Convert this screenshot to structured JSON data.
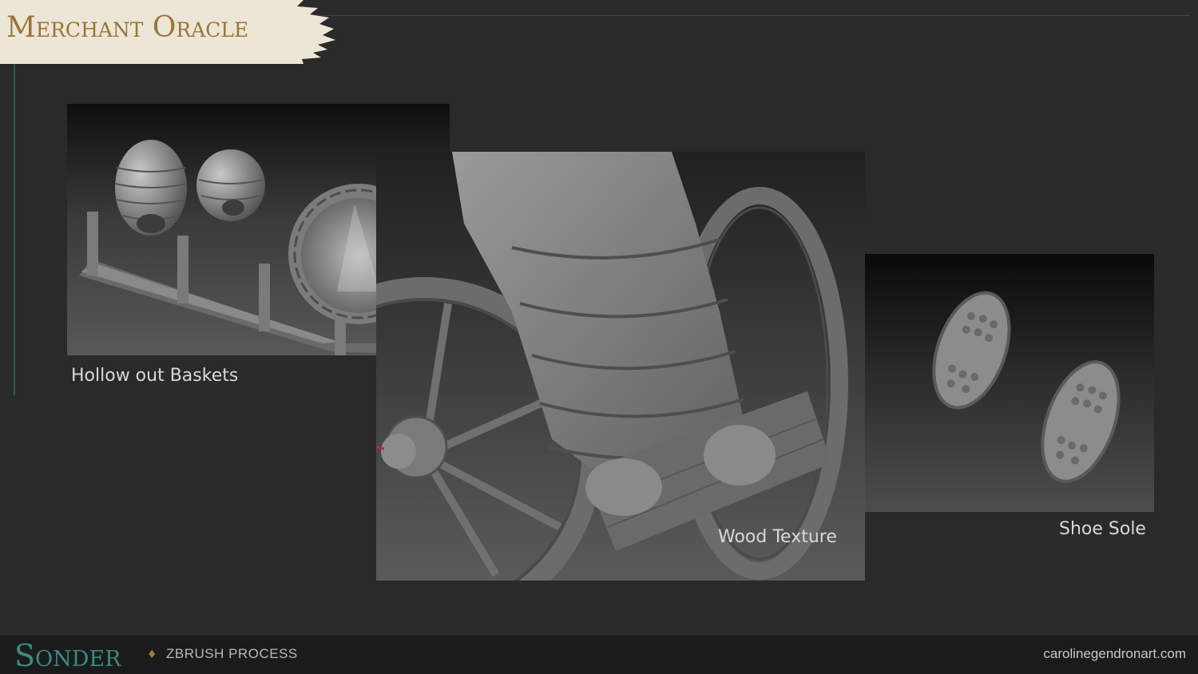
{
  "header": {
    "title": "Merchant Oracle"
  },
  "panels": [
    {
      "caption": "Hollow out Baskets"
    },
    {
      "caption": "Wood Texture"
    },
    {
      "caption": "Shoe Sole"
    }
  ],
  "footer": {
    "brand": "Sonder",
    "separator": "♦",
    "section": "ZBRUSH PROCESS",
    "website": "carolinegendronart.com"
  },
  "colors": {
    "background": "#2a2a2b",
    "accent_gold": "#9a7536",
    "accent_teal": "#3c8a82"
  }
}
